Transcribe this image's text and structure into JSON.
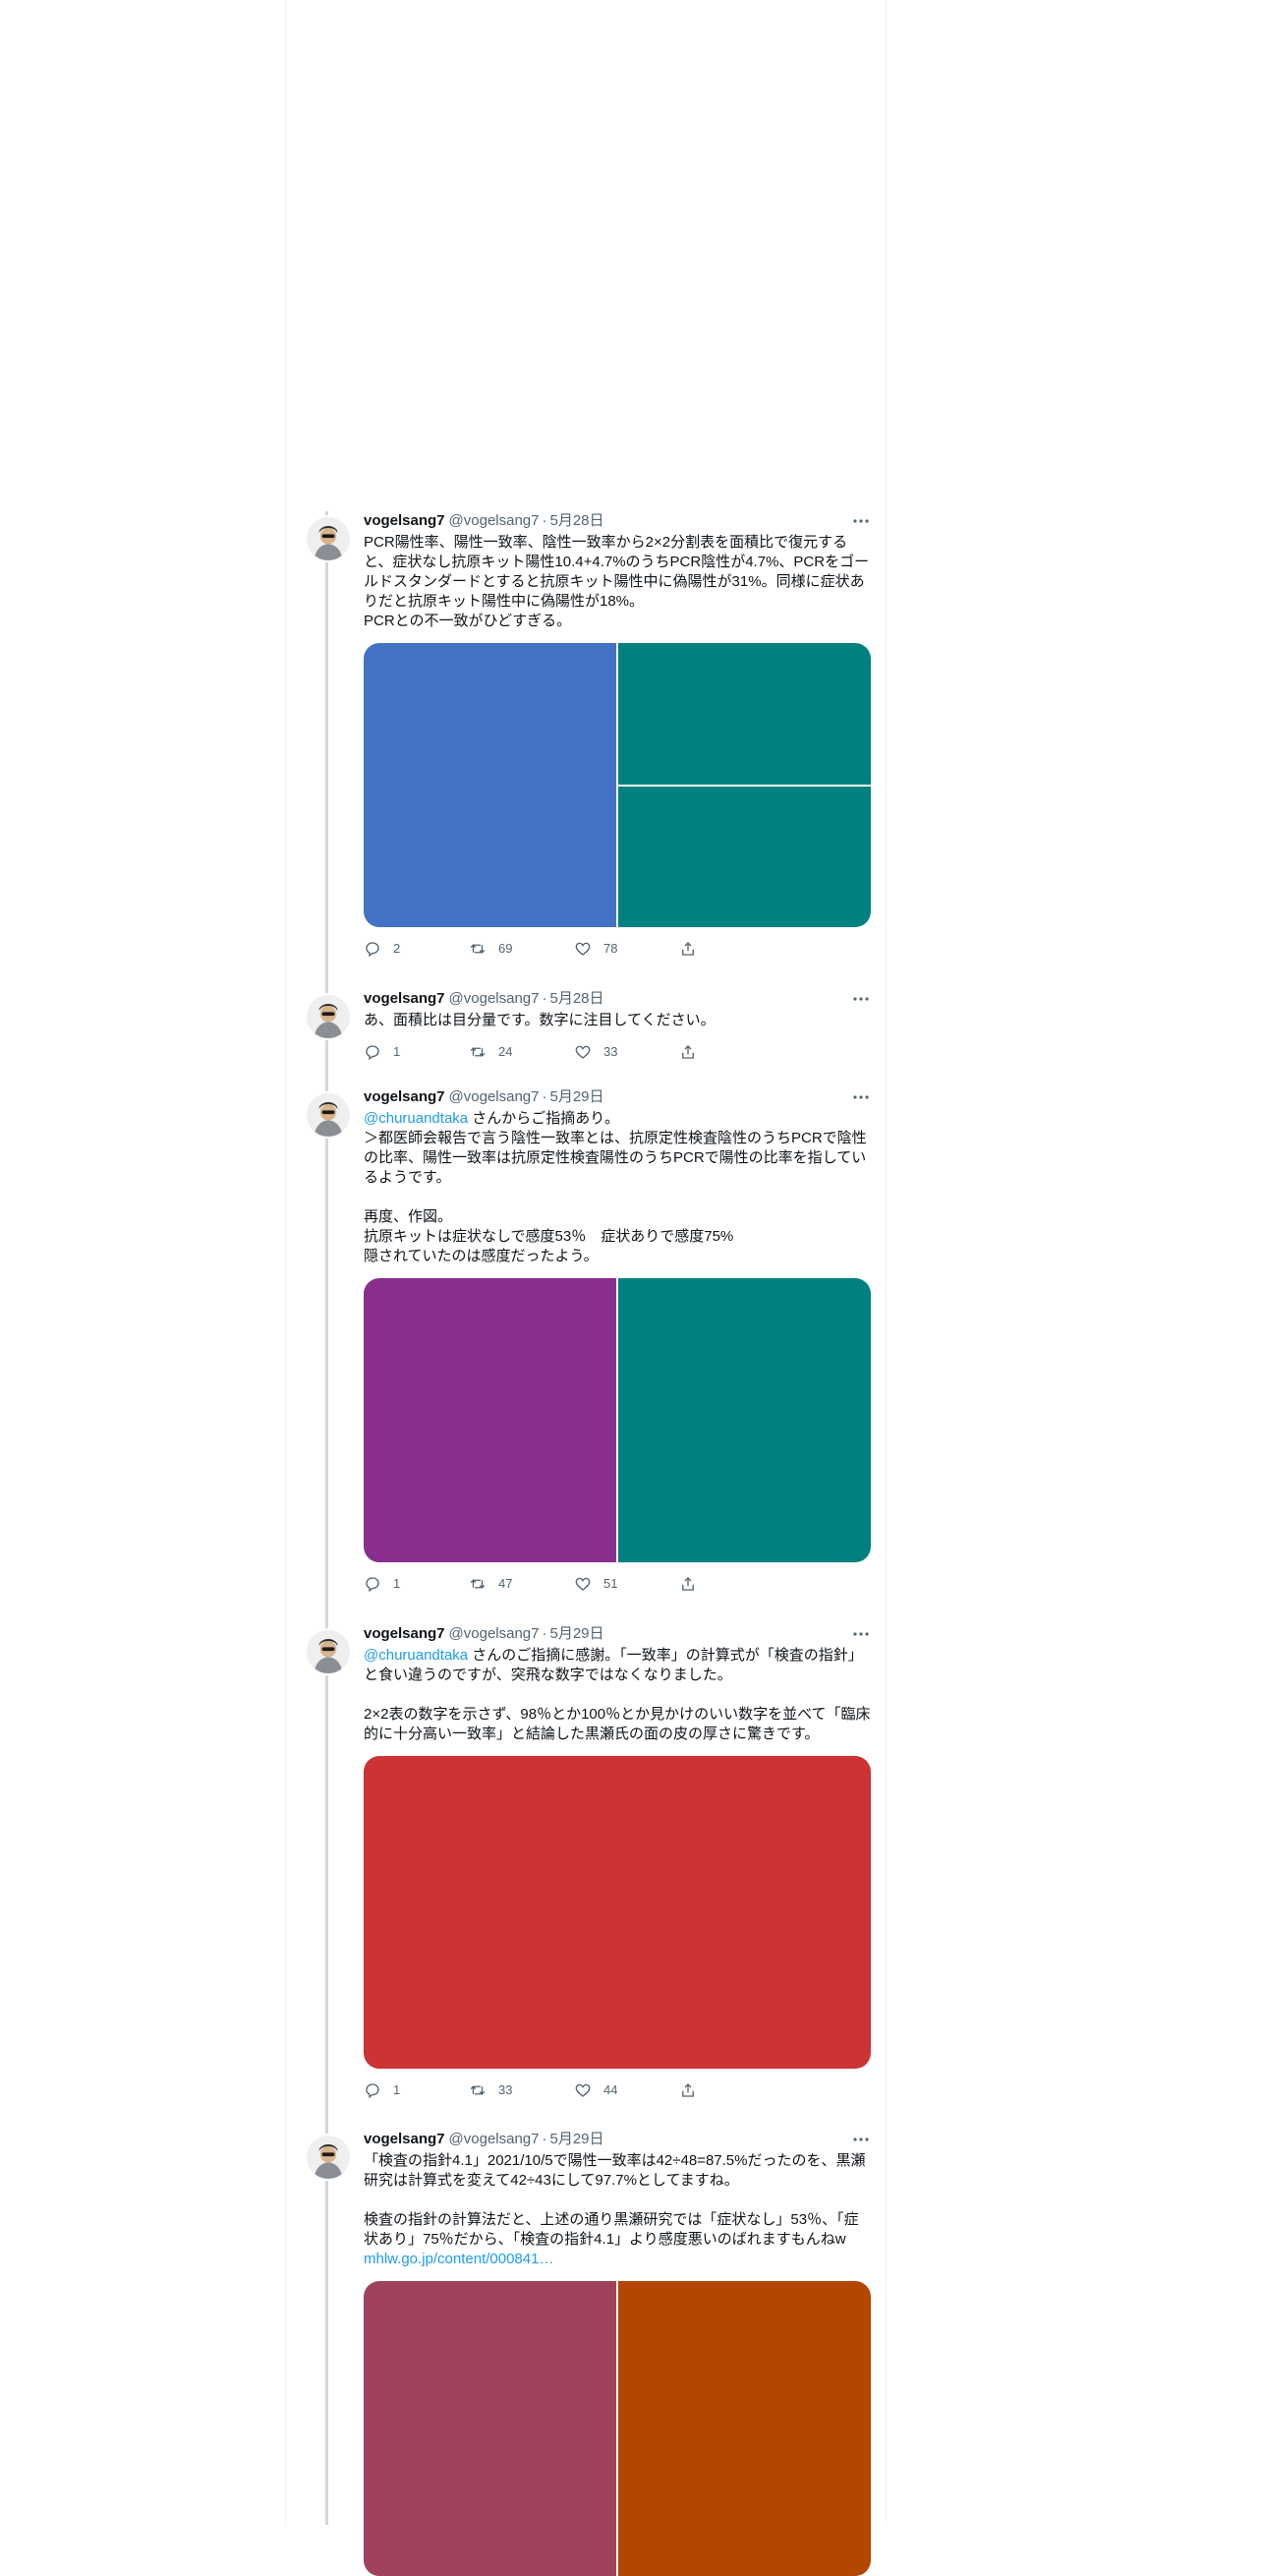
{
  "tweets": [
    {
      "name": "vogelsang7",
      "handle": "@vogelsang7",
      "separator": "·",
      "date": "5月28日",
      "text": "PCR陽性率、陽性一致率、陰性一致率から2×2分割表を面積比で復元すると、症状なし抗原キット陽性10.4+4.7%のうちPCR陰性が4.7%、PCRをゴールドスタンダードとすると抗原キット陽性中に偽陽性が31%。同様に症状ありだと抗原キット陽性中に偽陽性が18%。\nPCRとの不一致がひどすぎる。",
      "replies": "2",
      "retweets": "69",
      "likes": "78",
      "media": {
        "left": "#4472c4",
        "right_top": "#008080",
        "right_bottom": "#008080"
      }
    },
    {
      "name": "vogelsang7",
      "handle": "@vogelsang7",
      "separator": "·",
      "date": "5月28日",
      "text": "あ、面積比は目分量です。数字に注目してください。",
      "replies": "1",
      "retweets": "24",
      "likes": "33"
    },
    {
      "name": "vogelsang7",
      "handle": "@vogelsang7",
      "separator": "·",
      "date": "5月29日",
      "mention": "@churuandtaka",
      "text": " さんからご指摘あり。\n＞都医師会報告で言う陰性一致率とは、抗原定性検査陰性のうちPCRで陰性の比率、陽性一致率は抗原定性検査陽性のうちPCRで陽性の比率を指しているようです。\n\n再度、作図。\n抗原キットは症状なしで感度53％　症状ありで感度75%\n隠されていたのは感度だったよう。",
      "replies": "1",
      "retweets": "47",
      "likes": "51",
      "media": {
        "left": "#8b2f8f",
        "right": "#008080"
      }
    },
    {
      "name": "vogelsang7",
      "handle": "@vogelsang7",
      "separator": "·",
      "date": "5月29日",
      "mention": "@churuandtaka",
      "text": " さんのご指摘に感謝。「一致率」の計算式が「検査の指針」と食い違うのですが、突飛な数字ではなくなりました。\n\n2×2表の数字を示さず、98％とか100％とか見かけのいい数字を並べて「臨床的に十分高い一致率」と結論した黒瀬氏の面の皮の厚さに驚きです。",
      "replies": "1",
      "retweets": "33",
      "likes": "44",
      "media": {
        "full": "#cc3333"
      }
    },
    {
      "name": "vogelsang7",
      "handle": "@vogelsang7",
      "separator": "·",
      "date": "5月29日",
      "text": "「検査の指針4.1」2021/10/5で陽性一致率は42÷48=87.5%だったのを、黒瀬研究は計算式を変えて42÷43にして97.7%としてますね。\n\n検査の指針の計算法だと、上述の通り黒瀬研究では「症状なし」53％、「症状あり」75％だから、「検査の指針4.1」より感度悪いのばれますもんねw",
      "link": "mhlw.go.jp/content/000841…",
      "media": {
        "left": "#a0425c",
        "right": "#b34700"
      }
    }
  ]
}
